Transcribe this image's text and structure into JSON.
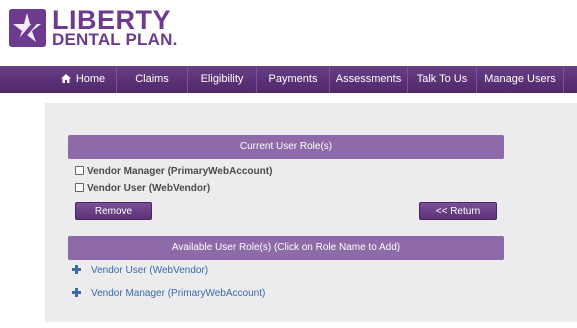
{
  "logo": {
    "line1": "LIBERTY",
    "line2": "DENTAL PLAN.",
    "icon": "liberty-star-icon"
  },
  "nav": {
    "items": [
      {
        "label": "Home",
        "icon": "home-icon"
      },
      {
        "label": "Claims"
      },
      {
        "label": "Eligibility"
      },
      {
        "label": "Payments"
      },
      {
        "label": "Assessments"
      },
      {
        "label": "Talk To Us"
      },
      {
        "label": "Manage Users"
      }
    ]
  },
  "current_roles": {
    "title": "Current User Role(s)",
    "roles": [
      {
        "label": "Vendor Manager (PrimaryWebAccount)",
        "checked": false
      },
      {
        "label": "Vendor User (WebVendor)",
        "checked": false
      }
    ],
    "remove_label": "Remove",
    "return_label": "<< Return"
  },
  "available_roles": {
    "title": "Available User Role(s) (Click on Role Name to Add)",
    "roles": [
      {
        "label": "Vendor User (WebVendor)"
      },
      {
        "label": "Vendor Manager (PrimaryWebAccount)"
      }
    ]
  },
  "colors": {
    "brand": "#6e3a8f",
    "nav": "#5a3177",
    "bar": "#8f6aa8",
    "link": "#3b6aa8",
    "panel": "#ecebed"
  }
}
